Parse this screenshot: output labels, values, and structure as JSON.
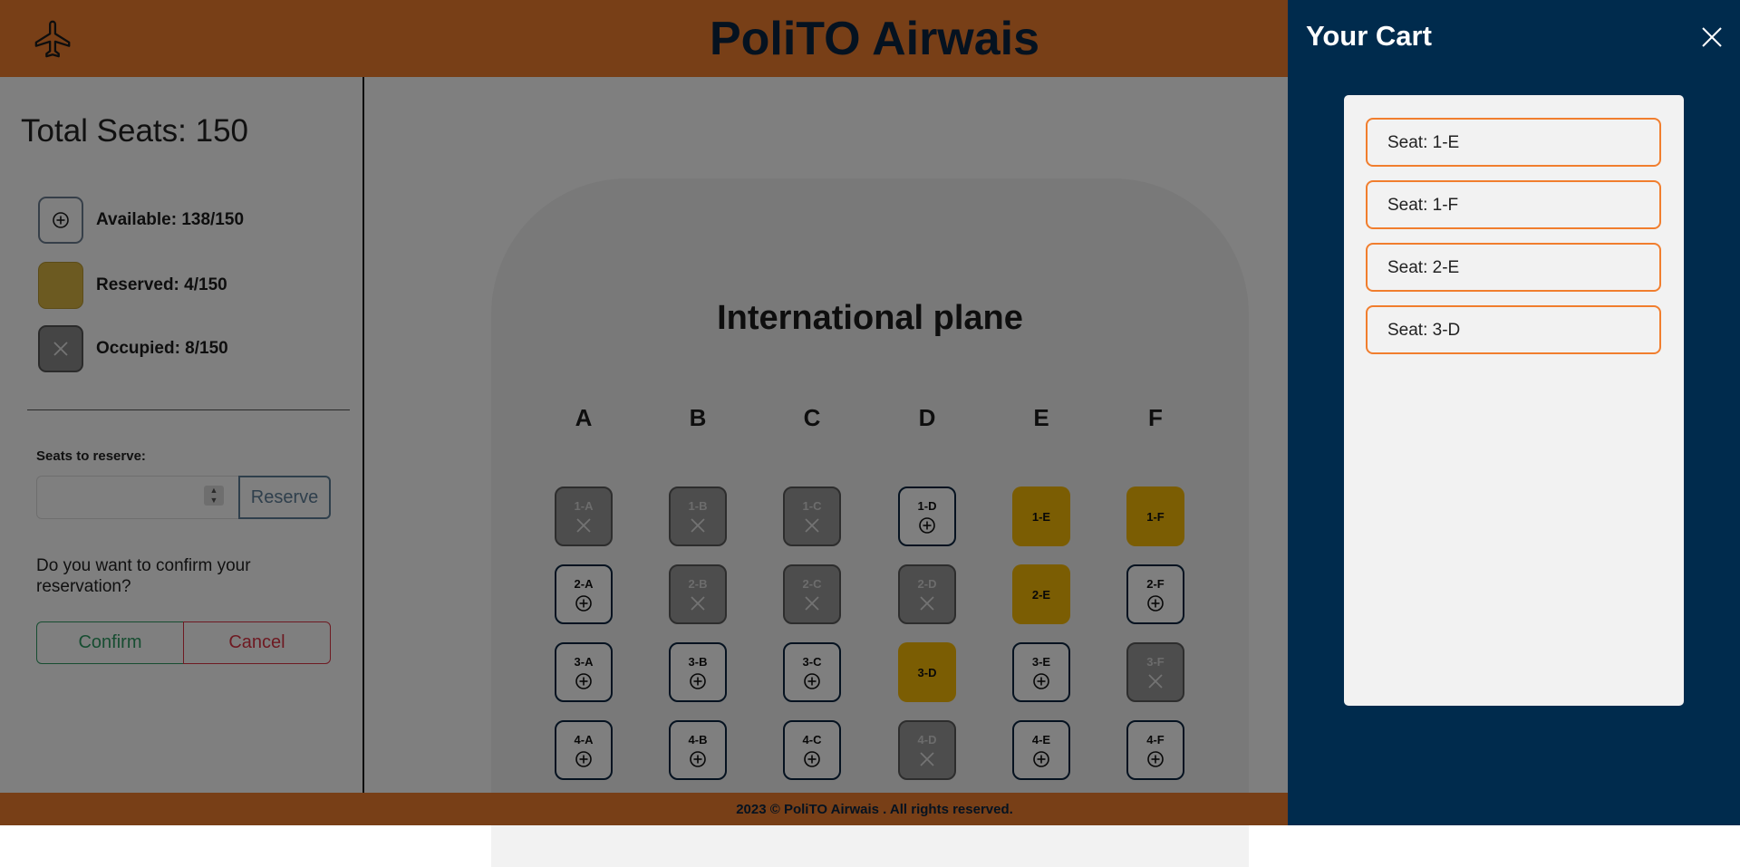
{
  "header": {
    "title": "PoliTO Airwais",
    "logo_icon": "airplane-icon",
    "background": "#F17E2E"
  },
  "sidebar": {
    "total_seats": "Total Seats: 150",
    "legend": [
      {
        "label": "Available: 138/150",
        "icon": "plus-circle-icon"
      },
      {
        "label": "Reserved: 4/150",
        "icon": "filled-box"
      },
      {
        "label": "Occupied: 8/150",
        "icon": "x-icon"
      }
    ],
    "seats_to_reserve_label": "Seats to reserve:",
    "seats_to_reserve_value": "",
    "reserve_button": "Reserve",
    "confirm_question": "Do you want to confirm your reservation?",
    "confirm_button": "Confirm",
    "cancel_button": "Cancel"
  },
  "plane": {
    "title": "International plane",
    "columns": [
      "A",
      "B",
      "C",
      "D",
      "E",
      "F"
    ],
    "seats": [
      {
        "label": "1-A",
        "status": "occupied"
      },
      {
        "label": "1-B",
        "status": "occupied"
      },
      {
        "label": "1-C",
        "status": "occupied"
      },
      {
        "label": "1-D",
        "status": "available"
      },
      {
        "label": "1-E",
        "status": "reserved"
      },
      {
        "label": "1-F",
        "status": "reserved"
      },
      {
        "label": "2-A",
        "status": "available"
      },
      {
        "label": "2-B",
        "status": "occupied"
      },
      {
        "label": "2-C",
        "status": "occupied"
      },
      {
        "label": "2-D",
        "status": "occupied"
      },
      {
        "label": "2-E",
        "status": "reserved"
      },
      {
        "label": "2-F",
        "status": "available"
      },
      {
        "label": "3-A",
        "status": "available"
      },
      {
        "label": "3-B",
        "status": "available"
      },
      {
        "label": "3-C",
        "status": "available"
      },
      {
        "label": "3-D",
        "status": "reserved"
      },
      {
        "label": "3-E",
        "status": "available"
      },
      {
        "label": "3-F",
        "status": "occupied"
      },
      {
        "label": "4-A",
        "status": "available"
      },
      {
        "label": "4-B",
        "status": "available"
      },
      {
        "label": "4-C",
        "status": "available"
      },
      {
        "label": "4-D",
        "status": "occupied"
      },
      {
        "label": "4-E",
        "status": "available"
      },
      {
        "label": "4-F",
        "status": "available"
      }
    ]
  },
  "footer": {
    "text": "2023 © PoliTO Airwais . All rights reserved."
  },
  "cart": {
    "title": "Your Cart",
    "close_icon": "close-icon",
    "items": [
      "Seat: 1-E",
      "Seat: 1-F",
      "Seat: 2-E",
      "Seat: 3-D"
    ]
  },
  "colors": {
    "brand_orange": "#F17E2E",
    "navy": "#002B4D",
    "reserved_yellow": "#F7BB07",
    "confirm_green": "#2e9b62",
    "cancel_red": "#dc3545"
  }
}
